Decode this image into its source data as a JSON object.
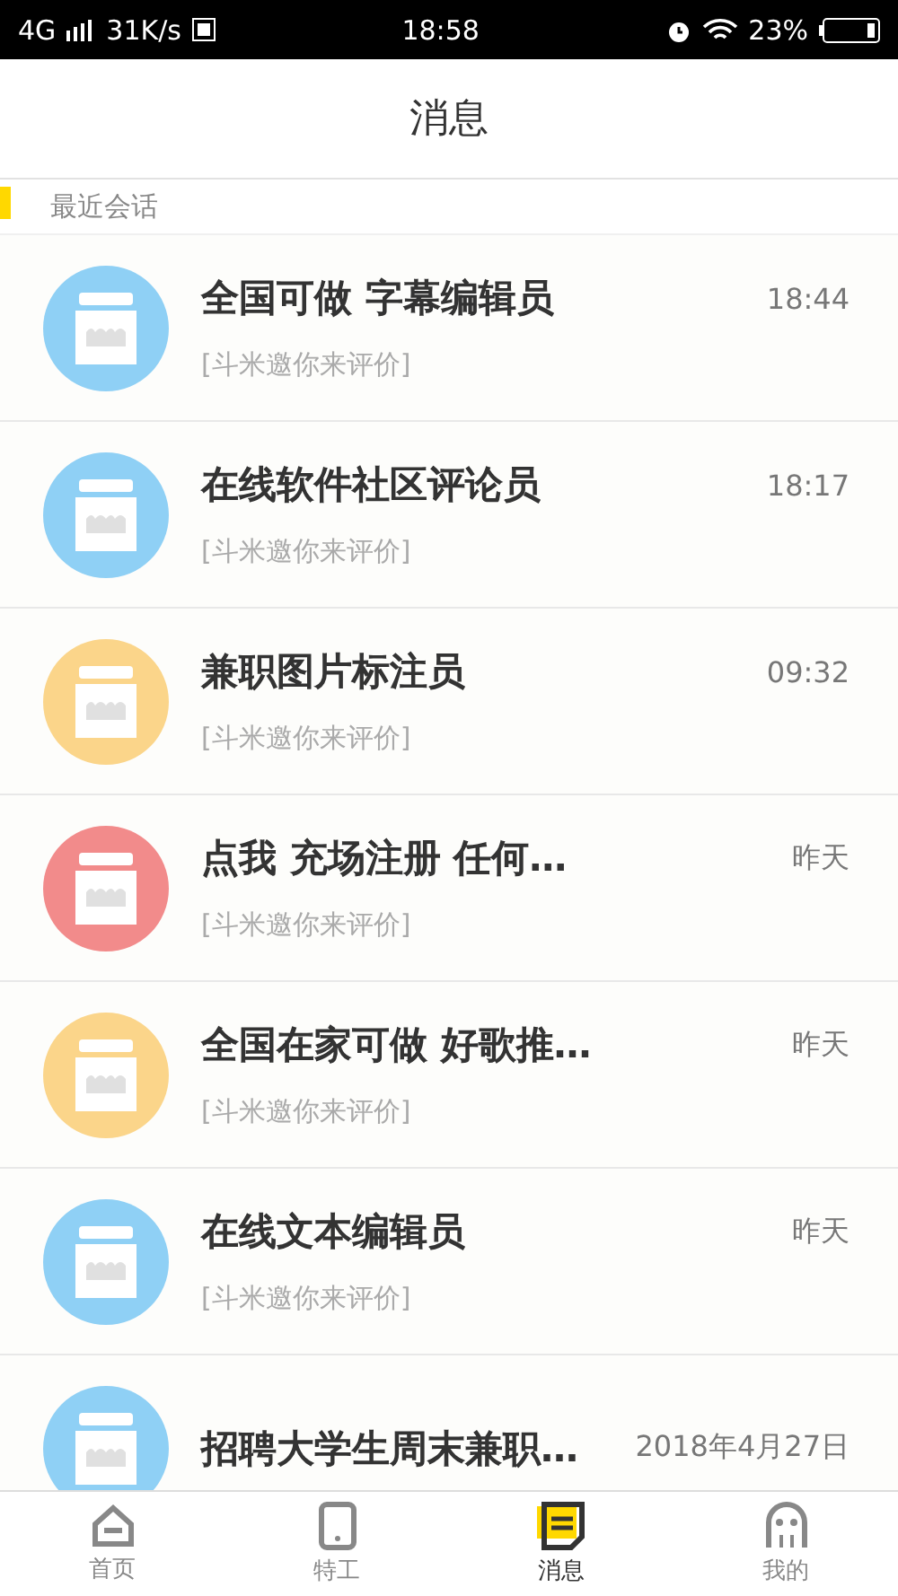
{
  "status_bar": {
    "network": "4G",
    "speed": "31K/s",
    "time": "18:58",
    "battery": "23%"
  },
  "header": {
    "title": "消息"
  },
  "section": {
    "title": "最近会话"
  },
  "conversations": [
    {
      "title": "全国可做 字幕编辑员",
      "subtitle": "[斗米邀你来评价]",
      "time": "18:44",
      "color": "#8fd0f5"
    },
    {
      "title": "在线软件社区评论员",
      "subtitle": "[斗米邀你来评价]",
      "time": "18:17",
      "color": "#8fd0f5"
    },
    {
      "title": "兼职图片标注员",
      "subtitle": "[斗米邀你来评价]",
      "time": "09:32",
      "color": "#fbd58a"
    },
    {
      "title": "点我 充场注册 任何…",
      "subtitle": "[斗米邀你来评价]",
      "time": "昨天",
      "color": "#f28b8b"
    },
    {
      "title": "全国在家可做 好歌推…",
      "subtitle": "[斗米邀你来评价]",
      "time": "昨天",
      "color": "#fbd58a"
    },
    {
      "title": "在线文本编辑员",
      "subtitle": "[斗米邀你来评价]",
      "time": "昨天",
      "color": "#8fd0f5"
    },
    {
      "title": "招聘大学生周末兼职…",
      "time": "2018年4月27日",
      "color": "#8fd0f5"
    }
  ],
  "tab_bar": [
    {
      "label": "首页",
      "kind": "home",
      "selected": false
    },
    {
      "label": "特工",
      "kind": "phone",
      "selected": false
    },
    {
      "label": "消息",
      "kind": "message",
      "selected": true
    },
    {
      "label": "我的",
      "kind": "ghost",
      "selected": false
    }
  ]
}
